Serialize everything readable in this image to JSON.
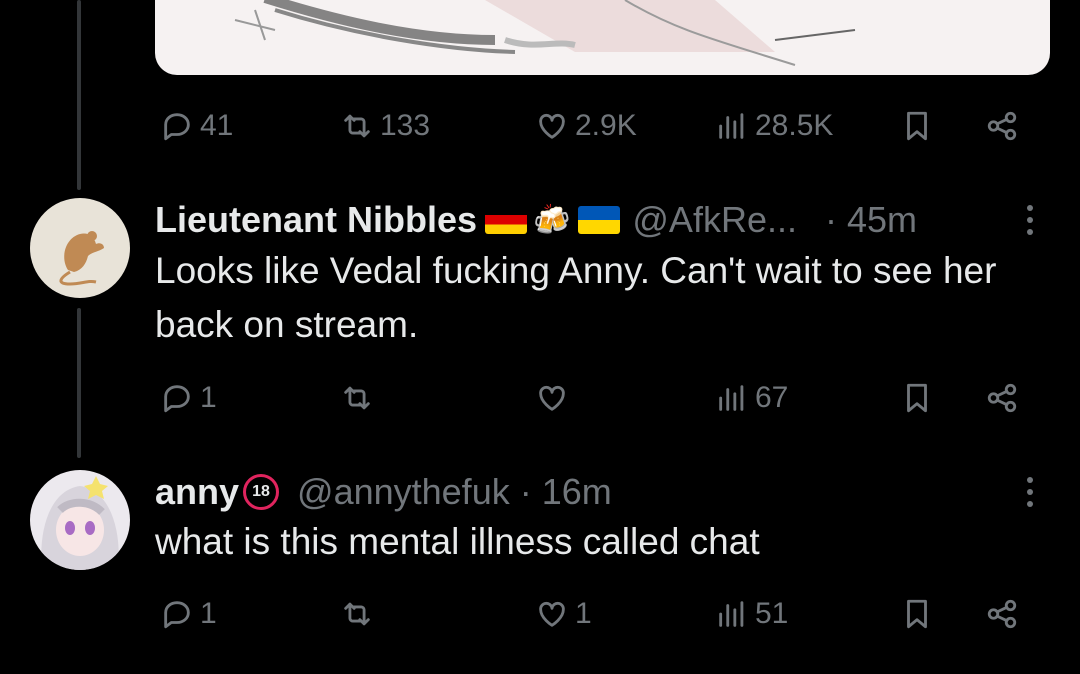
{
  "posts": [
    {
      "id": "top-post",
      "actions": {
        "replies": "41",
        "reposts": "133",
        "likes": "2.9K",
        "views": "28.5K"
      }
    },
    {
      "id": "reply-1",
      "author": {
        "name": "Lieutenant Nibbles",
        "emoji": "🍻",
        "handle": "@AfkRe...",
        "time": "· 45m"
      },
      "text": "Looks like Vedal fucking Anny. Can't wait to see her back on stream.",
      "actions": {
        "replies": "1",
        "reposts": "",
        "likes": "",
        "views": "67"
      }
    },
    {
      "id": "reply-2",
      "author": {
        "name": "anny",
        "badge": "18",
        "handle": "@annythefuk",
        "time": "· 16m"
      },
      "text": "what is this mental illness called chat",
      "actions": {
        "replies": "1",
        "reposts": "",
        "likes": "1",
        "views": "51"
      }
    }
  ],
  "icons": {
    "reply": "reply-icon",
    "repost": "repost-icon",
    "like": "heart-icon",
    "views": "views-icon",
    "bookmark": "bookmark-icon",
    "share": "share-icon",
    "more": "more-options-icon"
  }
}
